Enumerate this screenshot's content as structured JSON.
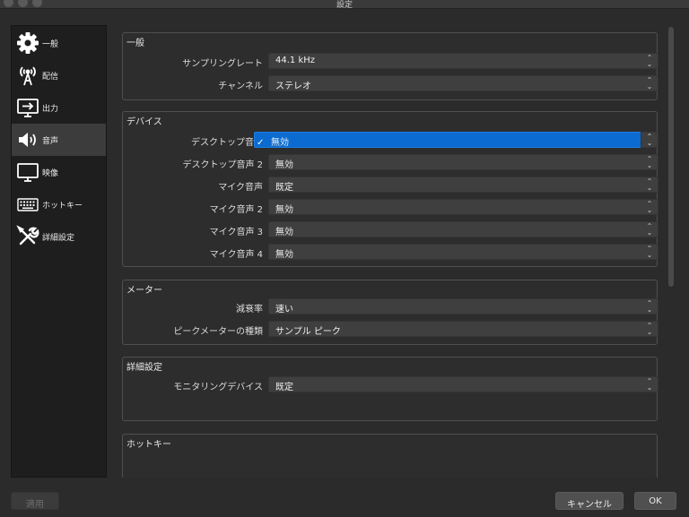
{
  "window": {
    "title": "設定"
  },
  "sidebar": {
    "items": [
      {
        "label": "一般",
        "icon": "gear-icon"
      },
      {
        "label": "配信",
        "icon": "broadcast-antenna-icon"
      },
      {
        "label": "出力",
        "icon": "output-monitor-icon"
      },
      {
        "label": "音声",
        "icon": "speaker-icon",
        "active": true
      },
      {
        "label": "映像",
        "icon": "monitor-icon"
      },
      {
        "label": "ホットキー",
        "icon": "keyboard-icon"
      },
      {
        "label": "詳細設定",
        "icon": "tools-icon"
      }
    ]
  },
  "general": {
    "title": "一般",
    "sample_rate_label": "サンプリングレート",
    "sample_rate_value": "44.1 kHz",
    "channels_label": "チャンネル",
    "channels_value": "ステレオ"
  },
  "devices": {
    "title": "デバイス",
    "desktop_audio_label": "デスクトップ音声",
    "desktop_audio_value": "無効",
    "desktop_audio_2_label": "デスクトップ音声 2",
    "desktop_audio_2_value": "無効",
    "mic_audio_label": "マイク音声",
    "mic_audio_value": "既定",
    "mic_audio_2_label": "マイク音声 2",
    "mic_audio_2_value": "無効",
    "mic_audio_3_label": "マイク音声 3",
    "mic_audio_3_value": "無効",
    "mic_audio_4_label": "マイク音声 4",
    "mic_audio_4_value": "無効"
  },
  "meters": {
    "title": "メーター",
    "decay_label": "減衰率",
    "decay_value": "速い",
    "peak_meter_label": "ピークメーターの種類",
    "peak_meter_value": "サンプル ピーク"
  },
  "advanced": {
    "title": "詳細設定",
    "monitoring_label": "モニタリングデバイス",
    "monitoring_value": "既定"
  },
  "hotkeys": {
    "title": "ホットキー"
  },
  "footer": {
    "apply": "適用",
    "cancel": "キャンセル",
    "ok": "OK"
  },
  "colors": {
    "accent": "#0b6bd1",
    "background": "#2b2b2b",
    "sidebar": "#1e1e1e"
  }
}
